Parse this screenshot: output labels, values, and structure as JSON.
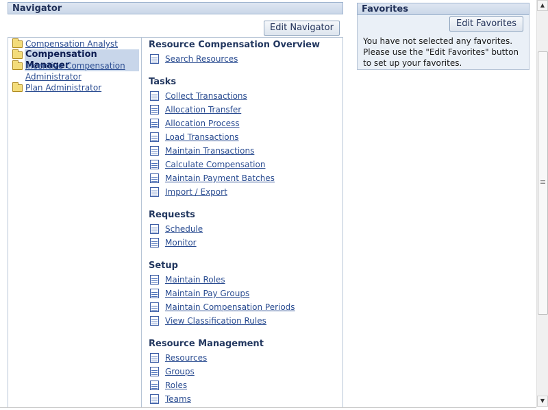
{
  "navigator": {
    "title": "Navigator",
    "edit_button": "Edit Navigator",
    "tree": [
      {
        "label": "Compensation Analyst",
        "selected": false
      },
      {
        "label": "Compensation Manager",
        "selected": true
      },
      {
        "label": "Incentive Compensation",
        "label2": "Administrator",
        "selected": false
      },
      {
        "label": "Plan Administrator",
        "selected": false
      }
    ],
    "groups": [
      {
        "title": "Resource Compensation Overview",
        "items": [
          "Search Resources"
        ]
      },
      {
        "title": "Tasks",
        "items": [
          "Collect Transactions",
          "Allocation Transfer",
          "Allocation Process",
          "Load Transactions",
          "Maintain Transactions",
          "Calculate Compensation",
          "Maintain Payment Batches",
          "Import / Export"
        ]
      },
      {
        "title": "Requests",
        "items": [
          "Schedule",
          "Monitor"
        ]
      },
      {
        "title": "Setup",
        "items": [
          "Maintain Roles",
          "Maintain Pay Groups",
          "Maintain Compensation Periods",
          "View Classification Rules"
        ]
      },
      {
        "title": "Resource Management",
        "items": [
          "Resources",
          "Groups",
          "Roles",
          "Teams"
        ]
      }
    ]
  },
  "favorites": {
    "title": "Favorites",
    "edit_button": "Edit Favorites",
    "message": "You have not selected any favorites. Please use the \"Edit Favorites\" button to set up your favorites."
  },
  "icons": {
    "folder": "folder-icon",
    "task": "document-icon"
  },
  "colors": {
    "header_bg": "#cad7e8",
    "link": "#2a4c91",
    "group_title": "#22375f",
    "favorites_bg": "#eaf0f7"
  }
}
